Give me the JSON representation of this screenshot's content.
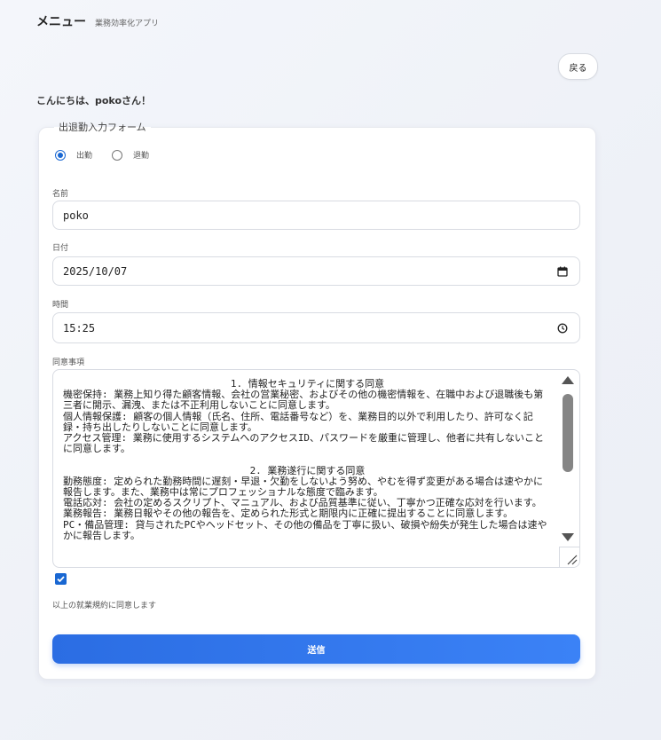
{
  "header": {
    "title": "メニュー",
    "subtitle": "業務効率化アプリ"
  },
  "back_button": {
    "label": "戻る"
  },
  "greeting": "こんにちは、pokoさん！",
  "form": {
    "legend": "出退勤入力フォーム",
    "radios": [
      {
        "label": "出勤",
        "checked": true
      },
      {
        "label": "退勤",
        "checked": false
      }
    ],
    "name": {
      "label": "名前",
      "value": "poko"
    },
    "date": {
      "label": "日付",
      "value": "2025/10/07",
      "icon": "calendar-icon"
    },
    "time": {
      "label": "時間",
      "value": "15:25",
      "icon": "clock-icon"
    },
    "consent": {
      "label": "同意事項",
      "heading1": "1. 情報セキュリティに関する同意",
      "paragraphs1": [
        "機密保持: 業務上知り得た顧客情報、会社の営業秘密、およびその他の機密情報を、在職中および退職後も第三者に開示、漏洩、または不正利用しないことに同意します。",
        "個人情報保護: 顧客の個人情報（氏名、住所、電話番号など）を、業務目的以外で利用したり、許可なく記録・持ち出したりしないことに同意します。",
        "アクセス管理: 業務に使用するシステムへのアクセスID、パスワードを厳重に管理し、他者に共有しないことに同意します。"
      ],
      "heading2": "2. 業務遂行に関する同意",
      "paragraphs2": [
        "勤務態度: 定められた勤務時間に遅刻・早退・欠勤をしないよう努め、やむを得ず変更がある場合は速やかに報告します。また、業務中は常にプロフェッショナルな態度で臨みます。",
        "電話応対: 会社の定めるスクリプト、マニュアル、および品質基準に従い、丁寧かつ正確な応対を行います。",
        "業務報告: 業務日報やその他の報告を、定められた形式と期限内に正確に提出することに同意します。",
        "PC・備品管理: 貸与されたPCやヘッドセット、その他の備品を丁寧に扱い、破損や紛失が発生した場合は速やかに報告します。"
      ]
    },
    "agree": {
      "checked": true,
      "label": "以上の就業規約に同意します"
    },
    "submit_label": "送信"
  },
  "colors": {
    "accent": "#1967d2",
    "button": "#2b6de3"
  }
}
